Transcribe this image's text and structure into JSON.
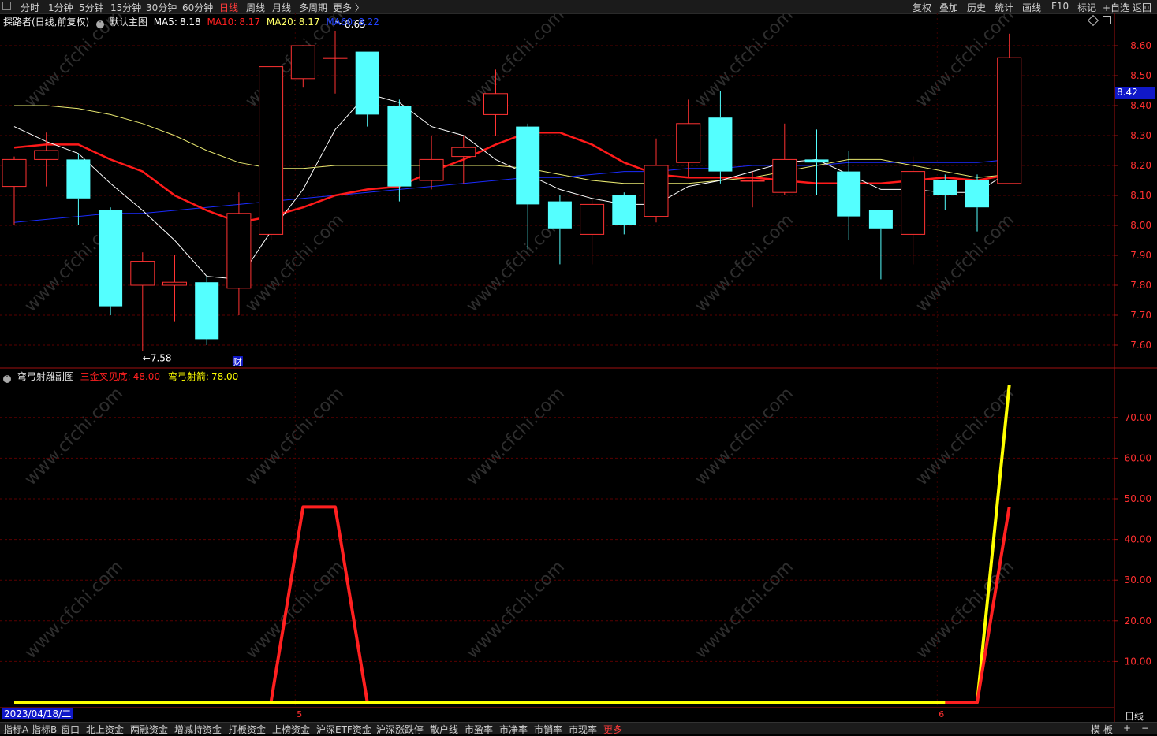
{
  "topbar": {
    "periods": [
      "分时",
      "1分钟",
      "5分钟",
      "15分钟",
      "30分钟",
      "60分钟",
      "日线",
      "周线",
      "月线",
      "多周期",
      "更多 〉"
    ],
    "active": "日线",
    "right_tools": [
      "复权",
      "叠加",
      "历史",
      "统计",
      "画线",
      "F10",
      "标记",
      "+自选",
      "返回"
    ]
  },
  "main_panel": {
    "stock_label": "探路者(日线,前复权)",
    "chart_label": "默认主图",
    "ma": [
      {
        "label": "MA5:",
        "value": "8.18",
        "color": "#ffffff"
      },
      {
        "label": "MA10:",
        "value": "8.17",
        "color": "#ff2020"
      },
      {
        "label": "MA20:",
        "value": "8.17",
        "color": "#ffff66"
      },
      {
        "label": "MA60:",
        "value": "8.22",
        "color": "#2233ff"
      }
    ],
    "high_marker": "8.65",
    "low_marker": "←7.58",
    "price_tag": "8.42",
    "cai_badge": "财"
  },
  "sub_panel": {
    "title": "弯弓射雕副图",
    "series": [
      {
        "label": "三金叉见底:",
        "value": "48.00",
        "color": "#ff2020"
      },
      {
        "label": "弯弓射箭:",
        "value": "78.00",
        "color": "#ffff00"
      }
    ]
  },
  "date_label": "2023/04/18/二",
  "period_label": "日线",
  "month_ticks": [
    "5",
    "6"
  ],
  "bottombar": {
    "tabs": [
      "指标A",
      "指标B",
      "窗口",
      "北上资金",
      "两融资金",
      "增减持资金",
      "打板资金",
      "上榜资金",
      "沪深ETF资金",
      "沪深涨跌停",
      "散户线",
      "市盈率",
      "市净率",
      "市销率",
      "市现率",
      "更多"
    ],
    "highlight": "更多",
    "right": [
      "模",
      "板",
      "+",
      "−"
    ]
  },
  "watermark": "www.cfchi.com",
  "chart_data": [
    {
      "type": "candlestick",
      "title": "",
      "ylim": [
        7.55,
        8.68
      ],
      "y_ticks": [
        "8.60",
        "8.50",
        "8.40",
        "8.30",
        "8.20",
        "8.10",
        "8.00",
        "7.90",
        "7.80",
        "7.70",
        "7.60"
      ],
      "candles": [
        {
          "o": 8.13,
          "h": 8.23,
          "l": 8.0,
          "c": 8.22
        },
        {
          "o": 8.22,
          "h": 8.31,
          "l": 8.13,
          "c": 8.25
        },
        {
          "o": 8.22,
          "h": 8.24,
          "l": 8.0,
          "c": 8.09
        },
        {
          "o": 8.05,
          "h": 8.06,
          "l": 7.7,
          "c": 7.73
        },
        {
          "o": 7.8,
          "h": 7.91,
          "l": 7.58,
          "c": 7.88
        },
        {
          "o": 7.8,
          "h": 7.9,
          "l": 7.68,
          "c": 7.81
        },
        {
          "o": 7.81,
          "h": 7.83,
          "l": 7.6,
          "c": 7.62
        },
        {
          "o": 7.79,
          "h": 8.11,
          "l": 7.7,
          "c": 8.04
        },
        {
          "o": 7.97,
          "h": 8.53,
          "l": 7.95,
          "c": 8.53
        },
        {
          "o": 8.49,
          "h": 8.6,
          "l": 8.46,
          "c": 8.6
        },
        {
          "o": 8.56,
          "h": 8.65,
          "l": 8.44,
          "c": 8.56
        },
        {
          "o": 8.58,
          "h": 8.58,
          "l": 8.33,
          "c": 8.37
        },
        {
          "o": 8.4,
          "h": 8.42,
          "l": 8.08,
          "c": 8.13
        },
        {
          "o": 8.15,
          "h": 8.3,
          "l": 8.12,
          "c": 8.22
        },
        {
          "o": 8.23,
          "h": 8.3,
          "l": 8.14,
          "c": 8.26
        },
        {
          "o": 8.37,
          "h": 8.52,
          "l": 8.3,
          "c": 8.44
        },
        {
          "o": 8.33,
          "h": 8.34,
          "l": 7.92,
          "c": 8.07
        },
        {
          "o": 8.08,
          "h": 8.1,
          "l": 7.87,
          "c": 7.99
        },
        {
          "o": 7.97,
          "h": 8.09,
          "l": 7.87,
          "c": 8.07
        },
        {
          "o": 8.1,
          "h": 8.11,
          "l": 7.97,
          "c": 8.0
        },
        {
          "o": 8.03,
          "h": 8.29,
          "l": 8.01,
          "c": 8.2
        },
        {
          "o": 8.21,
          "h": 8.42,
          "l": 8.16,
          "c": 8.34
        },
        {
          "o": 8.36,
          "h": 8.45,
          "l": 8.14,
          "c": 8.18
        },
        {
          "o": 8.15,
          "h": 8.18,
          "l": 8.06,
          "c": 8.15
        },
        {
          "o": 8.11,
          "h": 8.34,
          "l": 8.1,
          "c": 8.22
        },
        {
          "o": 8.22,
          "h": 8.32,
          "l": 8.1,
          "c": 8.21
        },
        {
          "o": 8.18,
          "h": 8.25,
          "l": 7.95,
          "c": 8.03
        },
        {
          "o": 8.05,
          "h": 8.05,
          "l": 7.82,
          "c": 7.99
        },
        {
          "o": 7.97,
          "h": 8.23,
          "l": 7.87,
          "c": 8.18
        },
        {
          "o": 8.15,
          "h": 8.17,
          "l": 8.05,
          "c": 8.1
        },
        {
          "o": 8.15,
          "h": 8.17,
          "l": 7.98,
          "c": 8.06
        },
        {
          "o": 8.14,
          "h": 8.64,
          "l": 8.14,
          "c": 8.56
        }
      ],
      "ma5": [
        8.33,
        8.28,
        8.24,
        8.14,
        8.05,
        7.95,
        7.83,
        7.82,
        7.98,
        8.12,
        8.32,
        8.44,
        8.41,
        8.33,
        8.3,
        8.22,
        8.17,
        8.12,
        8.09,
        8.07,
        8.07,
        8.13,
        8.15,
        8.18,
        8.21,
        8.22,
        8.17,
        8.12,
        8.12,
        8.11,
        8.11,
        8.18
      ],
      "ma10": [
        8.26,
        8.27,
        8.27,
        8.22,
        8.18,
        8.1,
        8.05,
        8.01,
        8.03,
        8.06,
        8.1,
        8.12,
        8.13,
        8.18,
        8.22,
        8.27,
        8.31,
        8.31,
        8.27,
        8.21,
        8.17,
        8.16,
        8.16,
        8.16,
        8.15,
        8.14,
        8.14,
        8.14,
        8.15,
        8.16,
        8.15,
        8.17
      ],
      "ma20": [
        8.4,
        8.4,
        8.39,
        8.37,
        8.34,
        8.3,
        8.25,
        8.21,
        8.19,
        8.19,
        8.2,
        8.2,
        8.2,
        8.2,
        8.2,
        8.2,
        8.19,
        8.17,
        8.15,
        8.14,
        8.14,
        8.14,
        8.15,
        8.16,
        8.18,
        8.2,
        8.22,
        8.22,
        8.2,
        8.18,
        8.16,
        8.17
      ],
      "ma60": [
        8.01,
        8.02,
        8.03,
        8.04,
        8.04,
        8.05,
        8.06,
        8.07,
        8.08,
        8.09,
        8.1,
        8.11,
        8.12,
        8.13,
        8.14,
        8.15,
        8.16,
        8.16,
        8.17,
        8.18,
        8.18,
        8.19,
        8.19,
        8.2,
        8.2,
        8.2,
        8.21,
        8.21,
        8.21,
        8.21,
        8.21,
        8.22
      ]
    },
    {
      "type": "line",
      "title": "弯弓射雕副图",
      "ylim": [
        0,
        82
      ],
      "y_ticks": [
        "70.00",
        "60.00",
        "50.00",
        "40.00",
        "30.00",
        "20.00",
        "10.00"
      ],
      "series": [
        {
          "name": "三金叉见底",
          "color": "#ff2020",
          "values": [
            0,
            0,
            0,
            0,
            0,
            0,
            0,
            0,
            0,
            48,
            48,
            0,
            0,
            0,
            0,
            0,
            0,
            0,
            0,
            0,
            0,
            0,
            0,
            0,
            0,
            0,
            0,
            0,
            0,
            0,
            0,
            48
          ]
        },
        {
          "name": "弯弓射箭",
          "color": "#ffff00",
          "values": [
            0,
            0,
            0,
            0,
            0,
            0,
            0,
            0,
            0,
            0,
            0,
            0,
            0,
            0,
            0,
            0,
            0,
            0,
            0,
            0,
            0,
            0,
            0,
            0,
            0,
            0,
            0,
            0,
            0,
            0,
            0,
            78
          ]
        }
      ]
    }
  ]
}
